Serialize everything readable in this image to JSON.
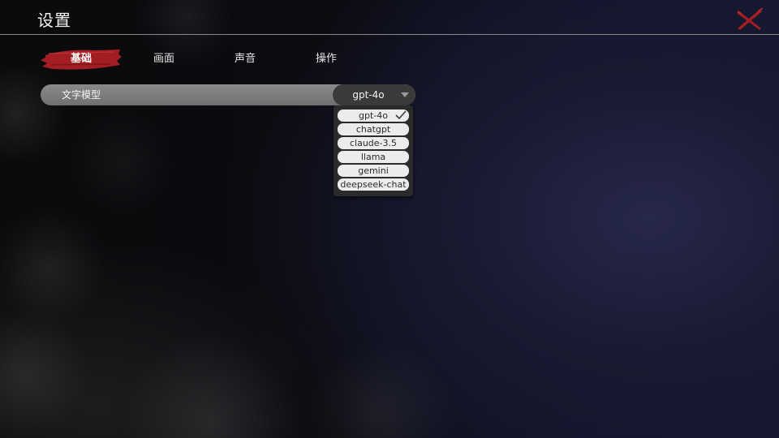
{
  "header": {
    "title": "设置",
    "close_icon": "close-x-icon"
  },
  "tabs": [
    {
      "label": "基础",
      "active": true
    },
    {
      "label": "画面",
      "active": false
    },
    {
      "label": "声音",
      "active": false
    },
    {
      "label": "操作",
      "active": false
    }
  ],
  "settings": {
    "text_model": {
      "label": "文字模型",
      "value": "gpt-4o",
      "options": [
        "gpt-4o",
        "chatgpt",
        "claude-3.5",
        "llama",
        "gemini",
        "deepseek-chat"
      ],
      "selected_index": 0
    }
  },
  "colors": {
    "accent": "#a31e22",
    "row_bg": "#7c7c7c",
    "select_bg": "#3a3a3a"
  }
}
